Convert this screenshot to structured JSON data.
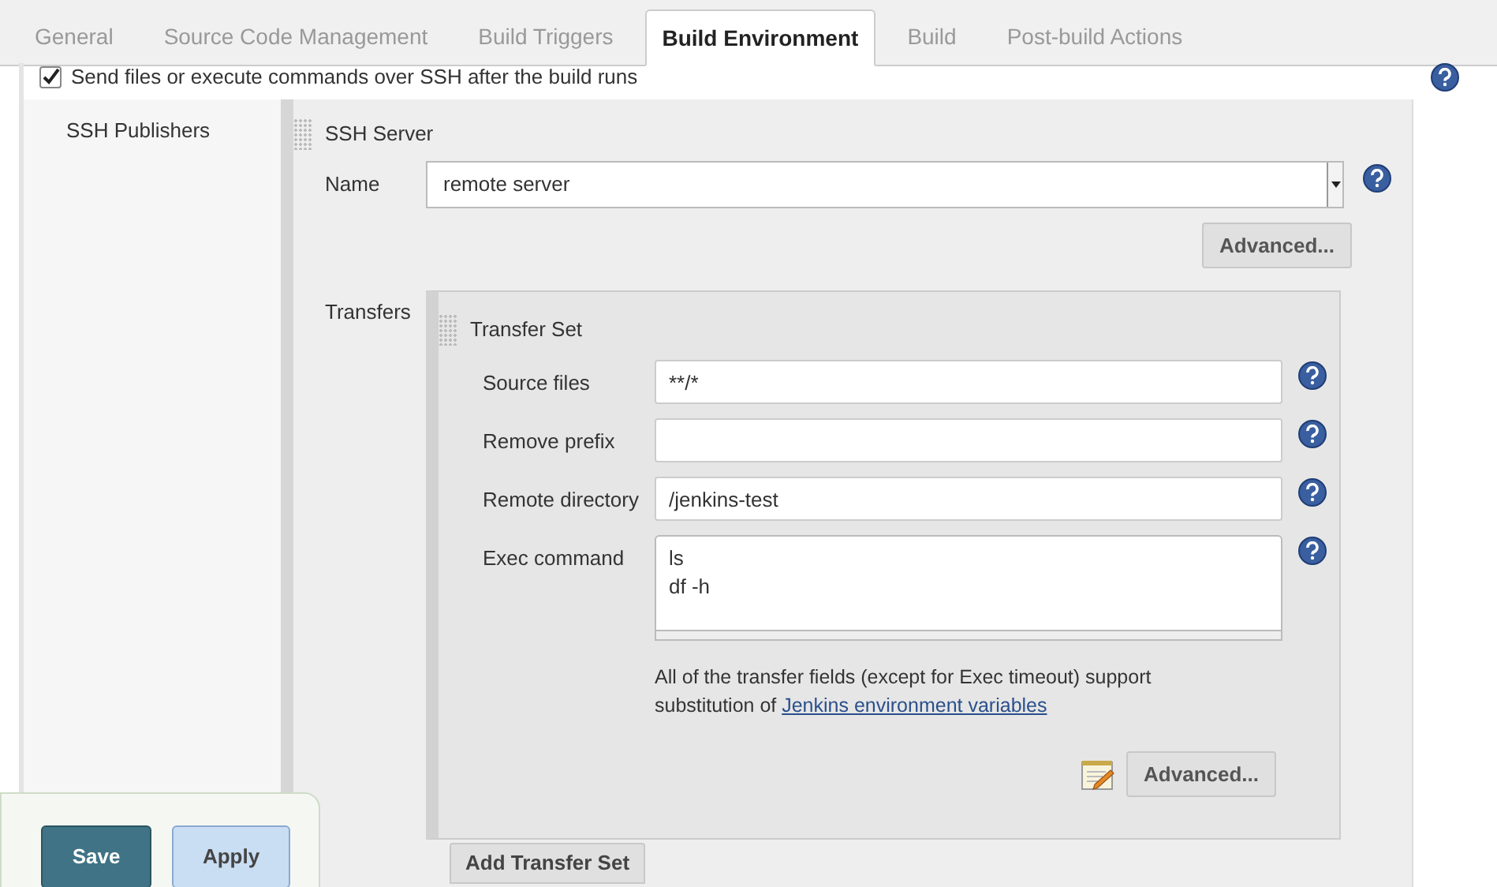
{
  "tabs": [
    {
      "label": "General",
      "selected": false
    },
    {
      "label": "Source Code Management",
      "selected": false
    },
    {
      "label": "Build Triggers",
      "selected": false
    },
    {
      "label": "Build Environment",
      "selected": true
    },
    {
      "label": "Build",
      "selected": false
    },
    {
      "label": "Post-build Actions",
      "selected": false
    }
  ],
  "ssh_option": {
    "label": "Send files or execute commands over SSH after the build runs",
    "checked": true
  },
  "publishers_label": "SSH Publishers",
  "ssh_server": {
    "title": "SSH Server",
    "name_label": "Name",
    "name_value": "remote server",
    "advanced_button": "Advanced...",
    "transfers_label": "Transfers",
    "transfer_set": {
      "title": "Transfer Set",
      "fields": [
        {
          "label": "Source files",
          "value": "**/*",
          "kind": "input"
        },
        {
          "label": "Remove prefix",
          "kind": "input"
        },
        {
          "label": "Remote directory",
          "value": "/jenkins-test",
          "kind": "input"
        },
        {
          "label": "Exec command",
          "value": "ls\ndf -h",
          "kind": "textarea"
        }
      ],
      "note": "All of the transfer fields (except for Exec timeout) support substitution of",
      "note_link": "Jenkins environment variables",
      "advanced_button": "Advanced..."
    },
    "add_transfer_button": "Add Transfer Set"
  },
  "save_button": "Save",
  "apply_button": "Apply"
}
